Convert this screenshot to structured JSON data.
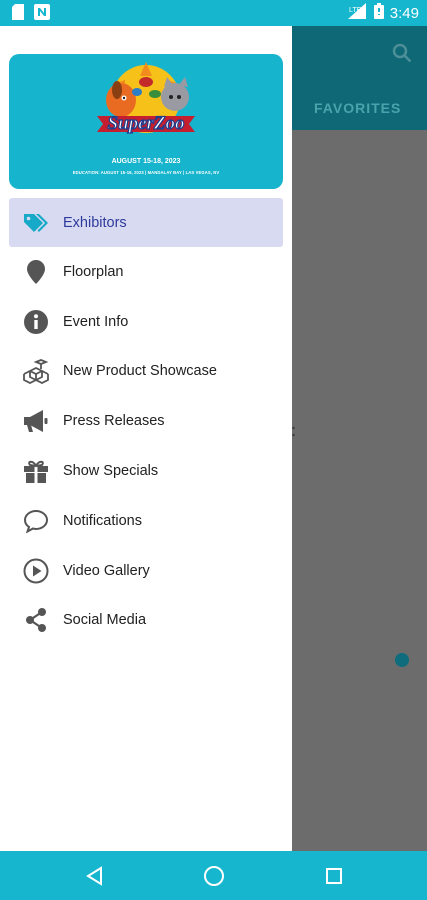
{
  "status_bar": {
    "time": "3:49",
    "icons": [
      "sd-card-icon",
      "n-notification-icon",
      "wifi-signal-icon",
      "battery-icon"
    ]
  },
  "background_app": {
    "tab_label": "FAVORITES",
    "icons": [
      "search-icon"
    ]
  },
  "banner": {
    "logo_text": "SuperZoo",
    "dates": "AUGUST 15-18, 2023",
    "subline": "EDUCATION: AUGUST 15-16, 2023  |  MANDALAY BAY | LAS VEGAS, NV"
  },
  "menu": {
    "items": [
      {
        "label": "Exhibitors",
        "icon": "tag-icon",
        "active": true
      },
      {
        "label": "Floorplan",
        "icon": "map-pin-icon",
        "active": false
      },
      {
        "label": "Event Info",
        "icon": "info-icon",
        "active": false
      },
      {
        "label": "New Product Showcase",
        "icon": "cubes-icon",
        "active": false
      },
      {
        "label": "Press Releases",
        "icon": "megaphone-icon",
        "active": false
      },
      {
        "label": "Show Specials",
        "icon": "gift-icon",
        "active": false
      },
      {
        "label": "Notifications",
        "icon": "chat-bubble-icon",
        "active": false
      },
      {
        "label": "Video Gallery",
        "icon": "play-circle-icon",
        "active": false
      },
      {
        "label": "Social Media",
        "icon": "share-icon",
        "active": false
      }
    ]
  },
  "nav_bar": {
    "icons": [
      "back-icon",
      "home-icon",
      "recents-icon"
    ]
  },
  "colors": {
    "accent": "#16b6cf",
    "active_bg": "#d8daf2",
    "active_text": "#2d3a9b",
    "scrim": "#6c6c6c"
  }
}
